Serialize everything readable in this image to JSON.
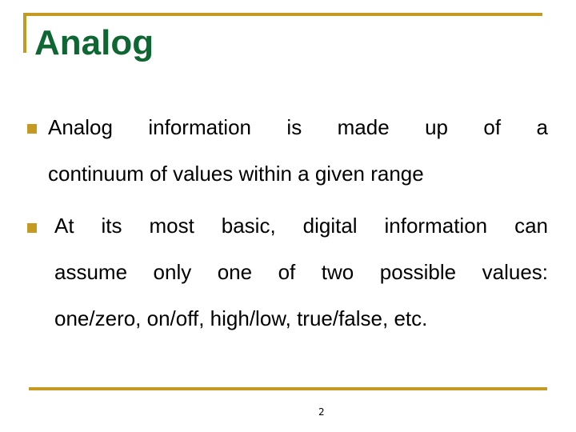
{
  "slide": {
    "title": "Analog",
    "bullets": [
      {
        "lines": [
          "Analog information is made up of a",
          "continuum of values within a given range"
        ]
      },
      {
        "lines": [
          "At its most basic, digital information can",
          "assume only one of two possible values:",
          "one/zero, on/off, high/low, true/false, etc."
        ]
      }
    ],
    "page_number": "2",
    "colors": {
      "accent": "#C49A22",
      "title": "#0E6632"
    }
  }
}
